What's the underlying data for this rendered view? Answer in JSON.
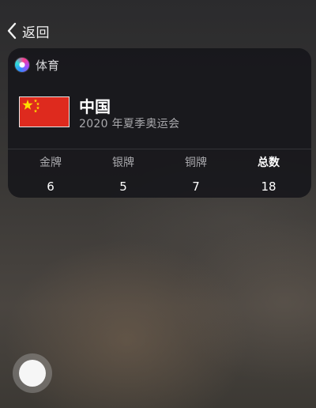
{
  "nav": {
    "back_label": "返回",
    "back_icon": "chevron-left-icon"
  },
  "card": {
    "app_icon": "siri-icon",
    "title": "体育",
    "country": "中国",
    "event": "2020 年夏季奥运会",
    "flag_icon": "china-flag-icon",
    "flag_colors": {
      "field": "#de2a1e",
      "stars": "#ffde00"
    },
    "medals": [
      {
        "label": "金牌",
        "value": "6"
      },
      {
        "label": "银牌",
        "value": "5"
      },
      {
        "label": "铜牌",
        "value": "7"
      },
      {
        "label": "总数",
        "value": "18"
      }
    ]
  },
  "home_button_icon": "home-button"
}
